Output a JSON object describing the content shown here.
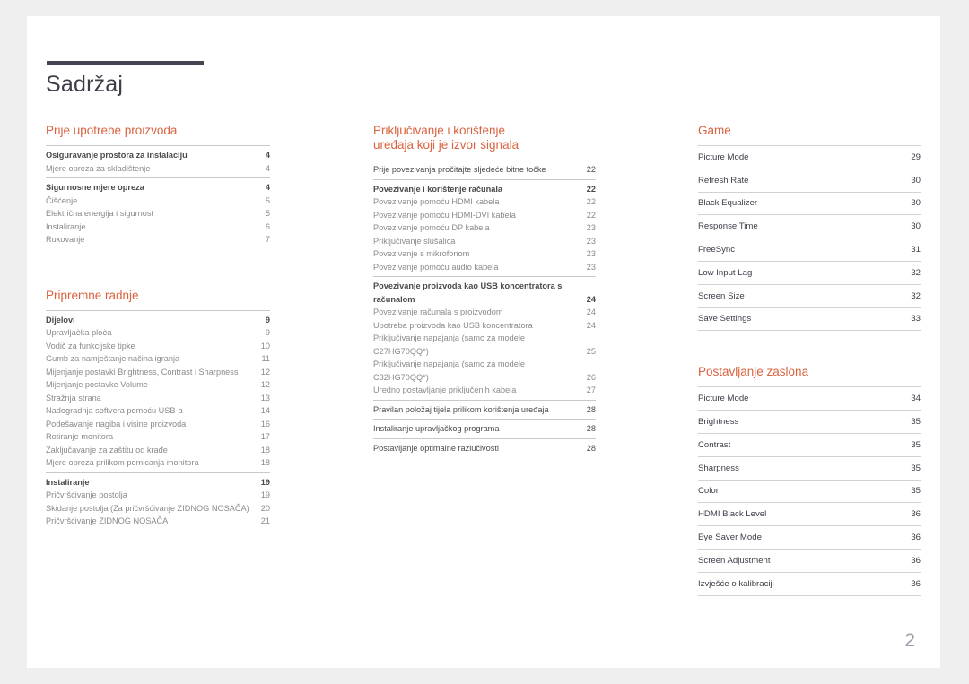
{
  "document": {
    "title": "Sadržaj",
    "page_number": "2",
    "accent_color": "#d9623f",
    "rule_color": "#46424f"
  },
  "columns": [
    {
      "id": "column-left",
      "sections": [
        {
          "title": "Prije upotrebe proizvoda",
          "style": "grouped",
          "groups": [
            {
              "entries": [
                {
                  "label": "Osiguravanje prostora za instalaciju",
                  "page": "4",
                  "head": true
                },
                {
                  "label": "Mjere opreza za skladištenje",
                  "page": "4",
                  "head": false
                }
              ]
            },
            {
              "entries": [
                {
                  "label": "Sigurnosne mjere opreza",
                  "page": "4",
                  "head": true
                },
                {
                  "label": "Čišćenje",
                  "page": "5",
                  "head": false
                },
                {
                  "label": "Električna energija i sigurnost",
                  "page": "5",
                  "head": false
                },
                {
                  "label": "Instaliranje",
                  "page": "6",
                  "head": false
                },
                {
                  "label": "Rukovanje",
                  "page": "7",
                  "head": false
                }
              ]
            }
          ]
        },
        {
          "title": "Pripremne radnje",
          "style": "grouped",
          "groups": [
            {
              "entries": [
                {
                  "label": "Dijelovi",
                  "page": "9",
                  "head": true
                },
                {
                  "label": "Upravljaèka ploèa",
                  "page": "9",
                  "head": false
                },
                {
                  "label": "Vodič za funkcijske tipke",
                  "page": "10",
                  "head": false
                },
                {
                  "label": "Gumb za namještanje načina igranja",
                  "page": "11",
                  "head": false
                },
                {
                  "label": "Mijenjanje postavki Brightness, Contrast i Sharpness",
                  "page": "12",
                  "head": false,
                  "wrap": true
                },
                {
                  "label": "Mijenjanje postavke Volume",
                  "page": "12",
                  "head": false
                },
                {
                  "label": "Stražnja strana",
                  "page": "13",
                  "head": false
                },
                {
                  "label": "Nadogradnja softvera pomoću USB-a",
                  "page": "14",
                  "head": false
                },
                {
                  "label": "Podešavanje nagiba i visine proizvoda",
                  "page": "16",
                  "head": false
                },
                {
                  "label": "Rotiranje monitora",
                  "page": "17",
                  "head": false
                },
                {
                  "label": "Zaključavanje za zaštitu od krađe",
                  "page": "18",
                  "head": false
                },
                {
                  "label": "Mjere opreza prilikom pomicanja monitora",
                  "page": "18",
                  "head": false
                }
              ]
            },
            {
              "entries": [
                {
                  "label": "Instaliranje",
                  "page": "19",
                  "head": true
                },
                {
                  "label": "Pričvršćivanje postolja",
                  "page": "19",
                  "head": false
                },
                {
                  "label": "Skidanje postolja (Za pričvršćivanje ZIDNOG NOSAČA)",
                  "page": "20",
                  "head": false,
                  "wrap": true
                },
                {
                  "label": "Pričvršćivanje ZIDNOG NOSAČA",
                  "page": "21",
                  "head": false
                }
              ]
            }
          ]
        }
      ]
    },
    {
      "id": "column-middle",
      "sections": [
        {
          "title": "Priključivanje i korištenje\nuređaja koji je izvor signala",
          "style": "grouped",
          "groups": [
            {
              "entries": [
                {
                  "label": "Prije povezivanja pročitajte sljedeće bitne točke",
                  "page": "22",
                  "head": false,
                  "plainhead": true
                }
              ]
            },
            {
              "entries": [
                {
                  "label": "Povezivanje i korištenje računala",
                  "page": "22",
                  "head": true
                },
                {
                  "label": "Povezivanje pomoću HDMI kabela",
                  "page": "22",
                  "head": false
                },
                {
                  "label": "Povezivanje pomoću HDMI-DVI kabela",
                  "page": "22",
                  "head": false
                },
                {
                  "label": "Povezivanje pomoću DP kabela",
                  "page": "23",
                  "head": false
                },
                {
                  "label": "Priključivanje slušalica",
                  "page": "23",
                  "head": false
                },
                {
                  "label": "Povezivanje s mikrofonom",
                  "page": "23",
                  "head": false
                },
                {
                  "label": "Povezivanje pomoću audio kabela",
                  "page": "23",
                  "head": false
                }
              ]
            },
            {
              "entries": [
                {
                  "label": "Povezivanje proizvoda kao USB koncentratora s računalom",
                  "page": "24",
                  "head": true,
                  "wrap": true
                },
                {
                  "label": "Povezivanje računala s proizvodom",
                  "page": "24",
                  "head": false
                },
                {
                  "label": "Upotreba proizvoda kao USB koncentratora",
                  "page": "24",
                  "head": false
                },
                {
                  "label": "Priključivanje napajanja (samo za modele C27HG70QQ*)",
                  "page": "25",
                  "head": false,
                  "wrap": true
                },
                {
                  "label": "Priključivanje napajanja (samo za modele C32HG70QQ*)",
                  "page": "26",
                  "head": false,
                  "wrap": true
                },
                {
                  "label": "Uredno postavljanje priključenih kabela",
                  "page": "27",
                  "head": false
                }
              ]
            },
            {
              "entries": [
                {
                  "label": "Pravilan položaj tijela prilikom korištenja uređaja",
                  "page": "28",
                  "head": false,
                  "plainhead": true
                }
              ]
            },
            {
              "entries": [
                {
                  "label": "Instaliranje upravljačkog programa",
                  "page": "28",
                  "head": false,
                  "plainhead": true
                }
              ]
            },
            {
              "entries": [
                {
                  "label": "Postavljanje optimalne razlučivosti",
                  "page": "28",
                  "head": false,
                  "plainhead": true
                }
              ]
            }
          ]
        }
      ]
    },
    {
      "id": "column-right",
      "sections": [
        {
          "title": "Game",
          "style": "ruled",
          "rows": [
            {
              "label": "Picture Mode",
              "page": "29"
            },
            {
              "label": "Refresh Rate",
              "page": "30"
            },
            {
              "label": "Black Equalizer",
              "page": "30"
            },
            {
              "label": "Response Time",
              "page": "30"
            },
            {
              "label": "FreeSync",
              "page": "31"
            },
            {
              "label": "Low Input Lag",
              "page": "32"
            },
            {
              "label": "Screen Size",
              "page": "32"
            },
            {
              "label": "Save Settings",
              "page": "33"
            }
          ]
        },
        {
          "title": "Postavljanje zaslona",
          "style": "ruled",
          "rows": [
            {
              "label": "Picture Mode",
              "page": "34"
            },
            {
              "label": "Brightness",
              "page": "35"
            },
            {
              "label": "Contrast",
              "page": "35"
            },
            {
              "label": "Sharpness",
              "page": "35"
            },
            {
              "label": "Color",
              "page": "35"
            },
            {
              "label": "HDMI Black Level",
              "page": "36"
            },
            {
              "label": "Eye Saver Mode",
              "page": "36"
            },
            {
              "label": "Screen Adjustment",
              "page": "36"
            },
            {
              "label": "Izvješće o kalibraciji",
              "page": "36"
            }
          ]
        }
      ]
    }
  ]
}
